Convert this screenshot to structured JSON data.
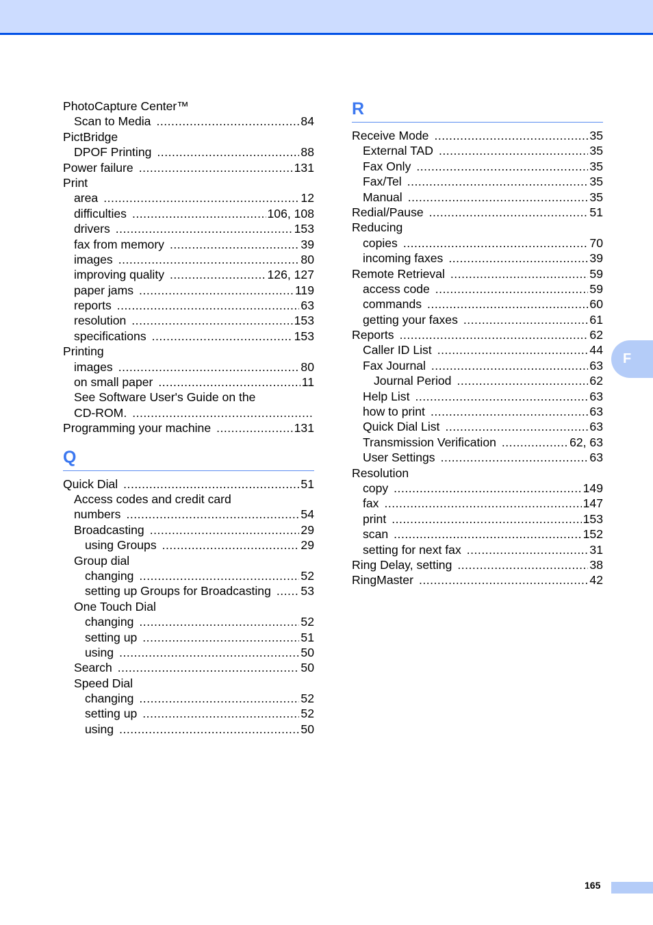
{
  "header": {
    "band_color": "#ccdcff",
    "rule_color": "#0050e6"
  },
  "side_tab": {
    "letter": "F",
    "color": "#b4ccf8"
  },
  "footer": {
    "page_number": "165"
  },
  "left_column": {
    "entries_p": [
      {
        "term": "PhotoCapture Center™",
        "page": "",
        "level": 0
      },
      {
        "term": "Scan to Media",
        "page": "84",
        "level": 1
      },
      {
        "term": "PictBridge",
        "page": "",
        "level": 0
      },
      {
        "term": "DPOF Printing",
        "page": "88",
        "level": 1
      },
      {
        "term": "Power failure",
        "page": "131",
        "level": 0
      },
      {
        "term": "Print",
        "page": "",
        "level": 0
      },
      {
        "term": "area",
        "page": "12",
        "level": 1
      },
      {
        "term": "difficulties",
        "page": "106, 108",
        "level": 1
      },
      {
        "term": "drivers",
        "page": "153",
        "level": 1
      },
      {
        "term": "fax from memory",
        "page": "39",
        "level": 1
      },
      {
        "term": "images",
        "page": "80",
        "level": 1
      },
      {
        "term": "improving quality",
        "page": "126, 127",
        "level": 1
      },
      {
        "term": "paper jams",
        "page": "119",
        "level": 1
      },
      {
        "term": "reports",
        "page": "63",
        "level": 1
      },
      {
        "term": "resolution",
        "page": "153",
        "level": 1
      },
      {
        "term": "specifications",
        "page": "153",
        "level": 1
      },
      {
        "term": "Printing",
        "page": "",
        "level": 0
      },
      {
        "term": "images",
        "page": "80",
        "level": 1
      },
      {
        "term": "on small paper",
        "page": "11",
        "level": 1
      },
      {
        "term": "See Software User's Guide on the",
        "page": "",
        "level": 1
      },
      {
        "term": "CD-ROM.",
        "page": "",
        "level": 1,
        "leader": true
      },
      {
        "term": "Programming your machine",
        "page": "131",
        "level": 0
      }
    ],
    "section_q": {
      "letter": "Q"
    },
    "entries_q": [
      {
        "term": "Quick Dial",
        "page": "51",
        "level": 0
      },
      {
        "term": "Access codes and credit card",
        "page": "",
        "level": 1
      },
      {
        "term": "numbers",
        "page": "54",
        "level": 1
      },
      {
        "term": "Broadcasting",
        "page": "29",
        "level": 1
      },
      {
        "term": "using Groups",
        "page": "29",
        "level": 2
      },
      {
        "term": "Group dial",
        "page": "",
        "level": 1
      },
      {
        "term": "changing",
        "page": "52",
        "level": 2
      },
      {
        "term": "setting up Groups for Broadcasting",
        "page": "53",
        "level": 2
      },
      {
        "term": "One Touch Dial",
        "page": "",
        "level": 1
      },
      {
        "term": "changing",
        "page": "52",
        "level": 2
      },
      {
        "term": "setting up",
        "page": "51",
        "level": 2
      },
      {
        "term": "using",
        "page": "50",
        "level": 2
      },
      {
        "term": "Search",
        "page": "50",
        "level": 1
      },
      {
        "term": "Speed Dial",
        "page": "",
        "level": 1
      },
      {
        "term": "changing",
        "page": "52",
        "level": 2
      },
      {
        "term": "setting up",
        "page": "52",
        "level": 2
      },
      {
        "term": "using",
        "page": "50",
        "level": 2
      }
    ]
  },
  "right_column": {
    "section_r": {
      "letter": "R"
    },
    "entries_r": [
      {
        "term": "Receive Mode",
        "page": "35",
        "level": 0
      },
      {
        "term": "External TAD",
        "page": "35",
        "level": 1
      },
      {
        "term": "Fax Only",
        "page": "35",
        "level": 1
      },
      {
        "term": "Fax/Tel",
        "page": "35",
        "level": 1
      },
      {
        "term": "Manual",
        "page": "35",
        "level": 1
      },
      {
        "term": "Redial/Pause",
        "page": "51",
        "level": 0
      },
      {
        "term": "Reducing",
        "page": "",
        "level": 0
      },
      {
        "term": "copies",
        "page": "70",
        "level": 1
      },
      {
        "term": "incoming faxes",
        "page": "39",
        "level": 1
      },
      {
        "term": "Remote Retrieval",
        "page": "59",
        "level": 0
      },
      {
        "term": "access code",
        "page": "59",
        "level": 1
      },
      {
        "term": "commands",
        "page": "60",
        "level": 1
      },
      {
        "term": "getting your faxes",
        "page": "61",
        "level": 1
      },
      {
        "term": "Reports",
        "page": "62",
        "level": 0
      },
      {
        "term": "Caller ID List",
        "page": "44",
        "level": 1
      },
      {
        "term": "Fax Journal",
        "page": "63",
        "level": 1
      },
      {
        "term": "Journal Period",
        "page": "62",
        "level": 2
      },
      {
        "term": "Help List",
        "page": "63",
        "level": 1
      },
      {
        "term": "how to print",
        "page": "63",
        "level": 1
      },
      {
        "term": "Quick Dial List",
        "page": "63",
        "level": 1
      },
      {
        "term": "Transmission Verification",
        "page": "62, 63",
        "level": 1
      },
      {
        "term": "User Settings",
        "page": "63",
        "level": 1
      },
      {
        "term": "Resolution",
        "page": "",
        "level": 0
      },
      {
        "term": "copy",
        "page": "149",
        "level": 1
      },
      {
        "term": "fax",
        "page": "147",
        "level": 1
      },
      {
        "term": "print",
        "page": "153",
        "level": 1
      },
      {
        "term": "scan",
        "page": "152",
        "level": 1
      },
      {
        "term": "setting for next fax",
        "page": "31",
        "level": 1
      },
      {
        "term": "Ring Delay, setting",
        "page": "38",
        "level": 0
      },
      {
        "term": "RingMaster",
        "page": "42",
        "level": 0
      }
    ]
  }
}
